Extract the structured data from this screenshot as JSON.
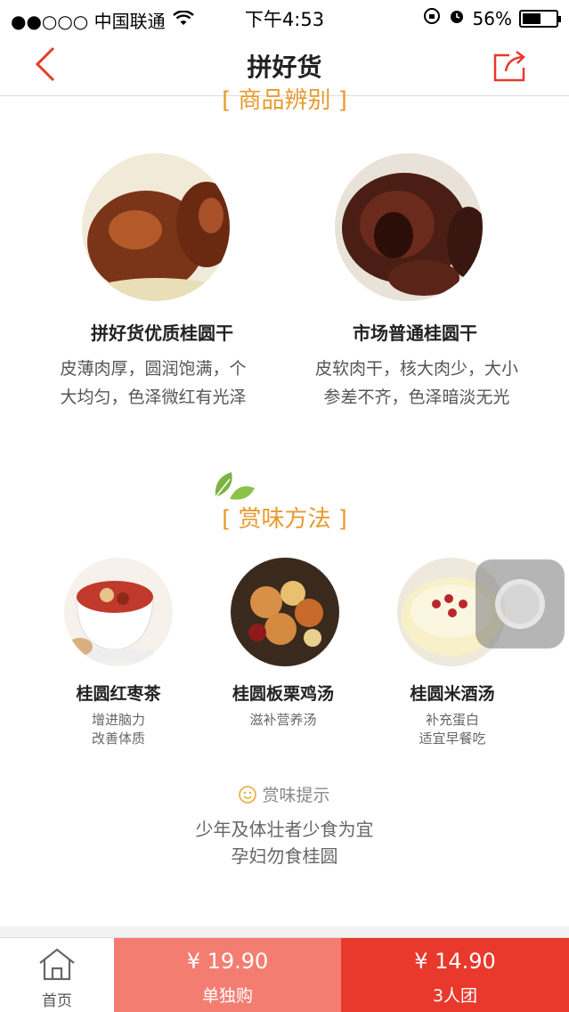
{
  "status_bar": {
    "carrier": "●●○○○ 中国联通",
    "time": "下午4:53",
    "battery": "56%",
    "battery_level": 0.56
  },
  "nav": {
    "title": "拼好货"
  },
  "compare": {
    "section_title": "[ 商品辨别 ]",
    "items": [
      {
        "name": "拼好货优质桂圆干",
        "desc_line1": "皮薄肉厚，圆润饱满，个",
        "desc_line2": "大均匀，色泽微红有光泽"
      },
      {
        "name": "市场普通桂圆干",
        "desc_line1": "皮软肉干，核大肉少，大小",
        "desc_line2": "参差不齐，色泽暗淡无光"
      }
    ]
  },
  "recipes": {
    "section_title": "[ 赏味方法 ]",
    "items": [
      {
        "name": "桂圆红枣茶",
        "line1": "增进脑力",
        "line2": "改善体质"
      },
      {
        "name": "桂圆板栗鸡汤",
        "line1": "滋补营养汤",
        "line2": ""
      },
      {
        "name": "桂圆米酒汤",
        "line1": "补充蛋白",
        "line2": "适宜早餐吃"
      }
    ]
  },
  "tips": {
    "title": "赏味提示",
    "line1": "少年及体壮者少食为宜",
    "line2": "孕妇勿食桂圆"
  },
  "bottom_bar": {
    "home_label": "首页",
    "single_price": "¥ 19.90",
    "single_label": "单独购",
    "group_price": "¥ 14.90",
    "group_label": "3人团"
  },
  "colors": {
    "accent_orange": "#e89a2d",
    "brand_red": "#e8392c",
    "light_red": "#f47d72"
  }
}
